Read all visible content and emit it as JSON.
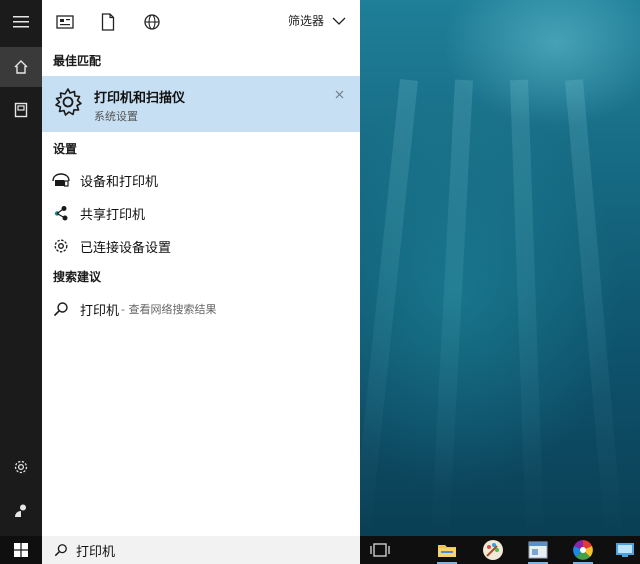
{
  "toolbar": {
    "filter_label": "筛选器",
    "icons": [
      "apps-icon",
      "document-icon",
      "globe-icon"
    ]
  },
  "best_match": {
    "heading": "最佳匹配",
    "title": "打印机和扫描仪",
    "subtitle": "系统设置"
  },
  "settings": {
    "heading": "设置",
    "items": [
      {
        "label": "设备和打印机",
        "icon": "devices-printers-icon"
      },
      {
        "label": "共享打印机",
        "icon": "share-icon"
      },
      {
        "label": "已连接设备设置",
        "icon": "gear-icon"
      }
    ]
  },
  "suggestions": {
    "heading": "搜索建议",
    "items": [
      {
        "label": "打印机",
        "sub": "- 查看网络搜索结果"
      }
    ]
  },
  "search": {
    "value": "打印机"
  },
  "colors": {
    "accent": "#c7dff3",
    "rail": "#1b1b1b",
    "taskbar": "#0f0f0f"
  }
}
